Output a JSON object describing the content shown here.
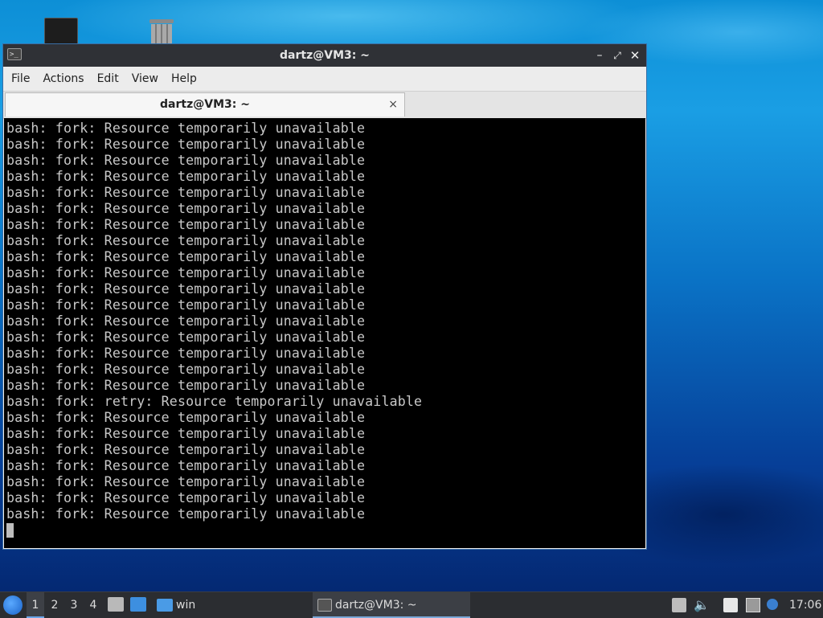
{
  "window": {
    "title": "dartz@VM3: ~",
    "controls": {
      "minimize": "–",
      "maximize": "⤢",
      "close": "✕"
    }
  },
  "menubar": {
    "items": [
      "File",
      "Actions",
      "Edit",
      "View",
      "Help"
    ]
  },
  "tab": {
    "label": "dartz@VM3: ~",
    "close": "×"
  },
  "terminal": {
    "lines": [
      "bash: fork: Resource temporarily unavailable",
      "bash: fork: Resource temporarily unavailable",
      "bash: fork: Resource temporarily unavailable",
      "bash: fork: Resource temporarily unavailable",
      "bash: fork: Resource temporarily unavailable",
      "bash: fork: Resource temporarily unavailable",
      "bash: fork: Resource temporarily unavailable",
      "bash: fork: Resource temporarily unavailable",
      "bash: fork: Resource temporarily unavailable",
      "bash: fork: Resource temporarily unavailable",
      "bash: fork: Resource temporarily unavailable",
      "bash: fork: Resource temporarily unavailable",
      "bash: fork: Resource temporarily unavailable",
      "bash: fork: Resource temporarily unavailable",
      "bash: fork: Resource temporarily unavailable",
      "bash: fork: Resource temporarily unavailable",
      "bash: fork: Resource temporarily unavailable",
      "bash: fork: retry: Resource temporarily unavailable",
      "bash: fork: Resource temporarily unavailable",
      "bash: fork: Resource temporarily unavailable",
      "bash: fork: Resource temporarily unavailable",
      "bash: fork: Resource temporarily unavailable",
      "bash: fork: Resource temporarily unavailable",
      "bash: fork: Resource temporarily unavailable",
      "bash: fork: Resource temporarily unavailable"
    ]
  },
  "taskbar": {
    "workspaces": [
      "1",
      "2",
      "3",
      "4"
    ],
    "active_workspace": "1",
    "folder_label": "win",
    "task_label": "dartz@VM3: ~",
    "clock": "17:06"
  },
  "colors": {
    "accent": "#6aa5e8",
    "terminal_bg": "#000000",
    "terminal_fg": "#c8c8c8",
    "titlebar": "#2f3136"
  }
}
